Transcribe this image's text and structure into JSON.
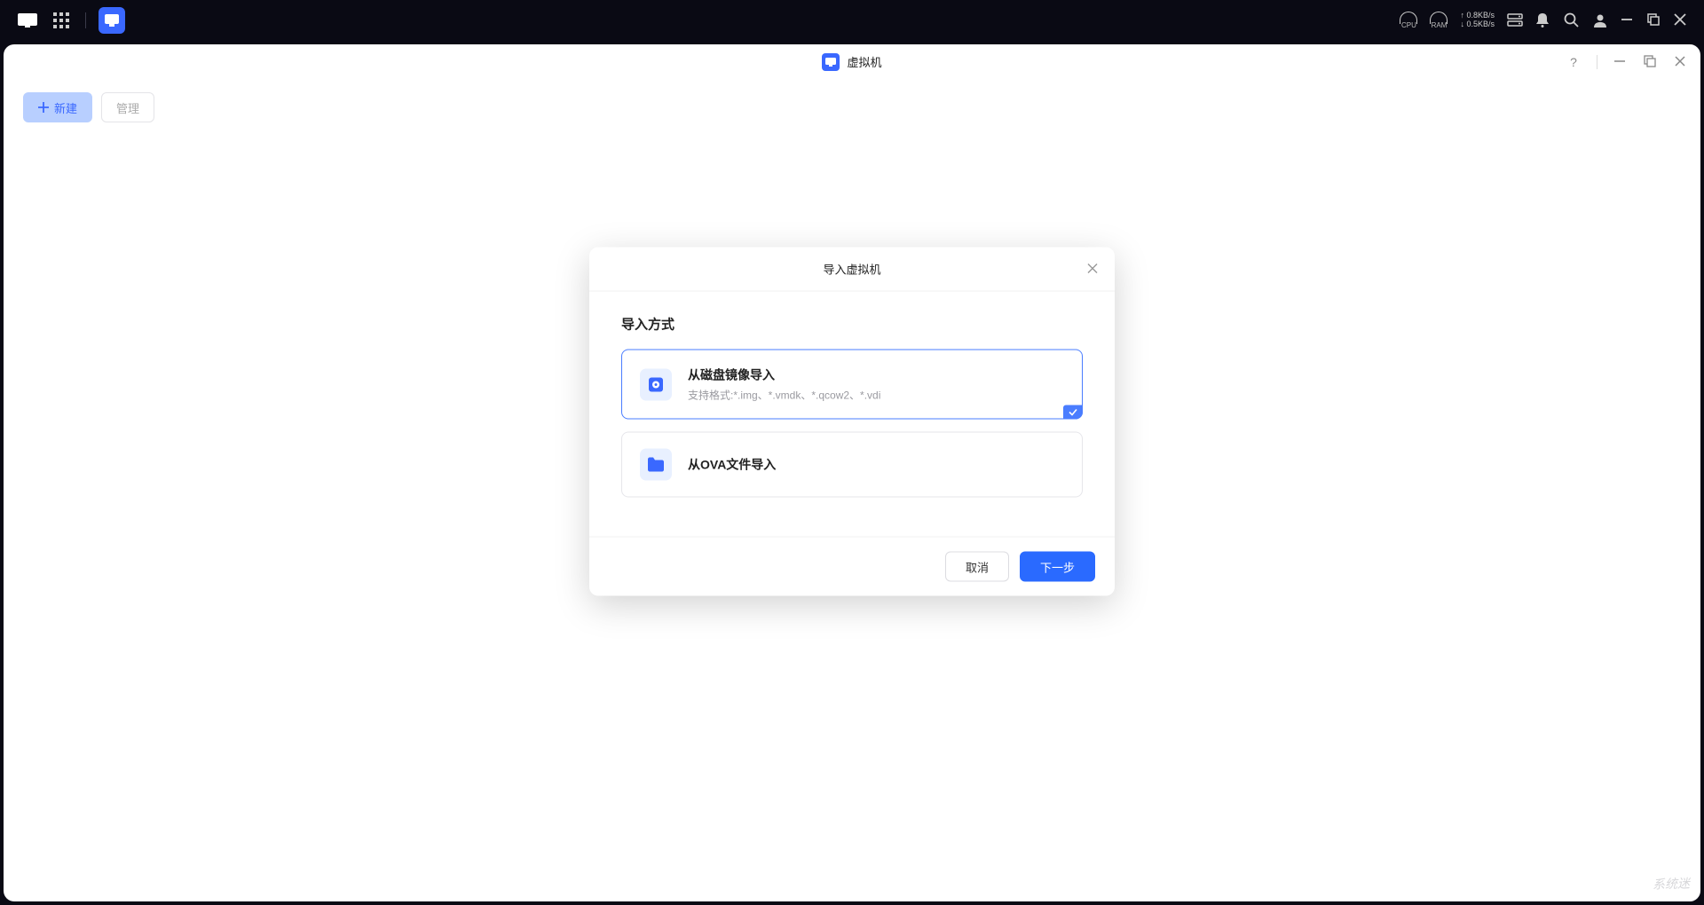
{
  "taskbar": {
    "cpu_label": "CPU",
    "ram_label": "RAM",
    "net_up": "↑ 0.8KB/s",
    "net_down": "↓ 0.5KB/s"
  },
  "app": {
    "title": "虚拟机",
    "new_button": "新建",
    "manage_button": "管理"
  },
  "modal": {
    "title": "导入虚拟机",
    "section_title": "导入方式",
    "option1_title": "从磁盘镜像导入",
    "option1_sub": "支持格式:*.img、*.vmdk、*.qcow2、*.vdi",
    "option2_title": "从OVA文件导入",
    "cancel": "取消",
    "next": "下一步"
  },
  "watermark": "系统迷"
}
